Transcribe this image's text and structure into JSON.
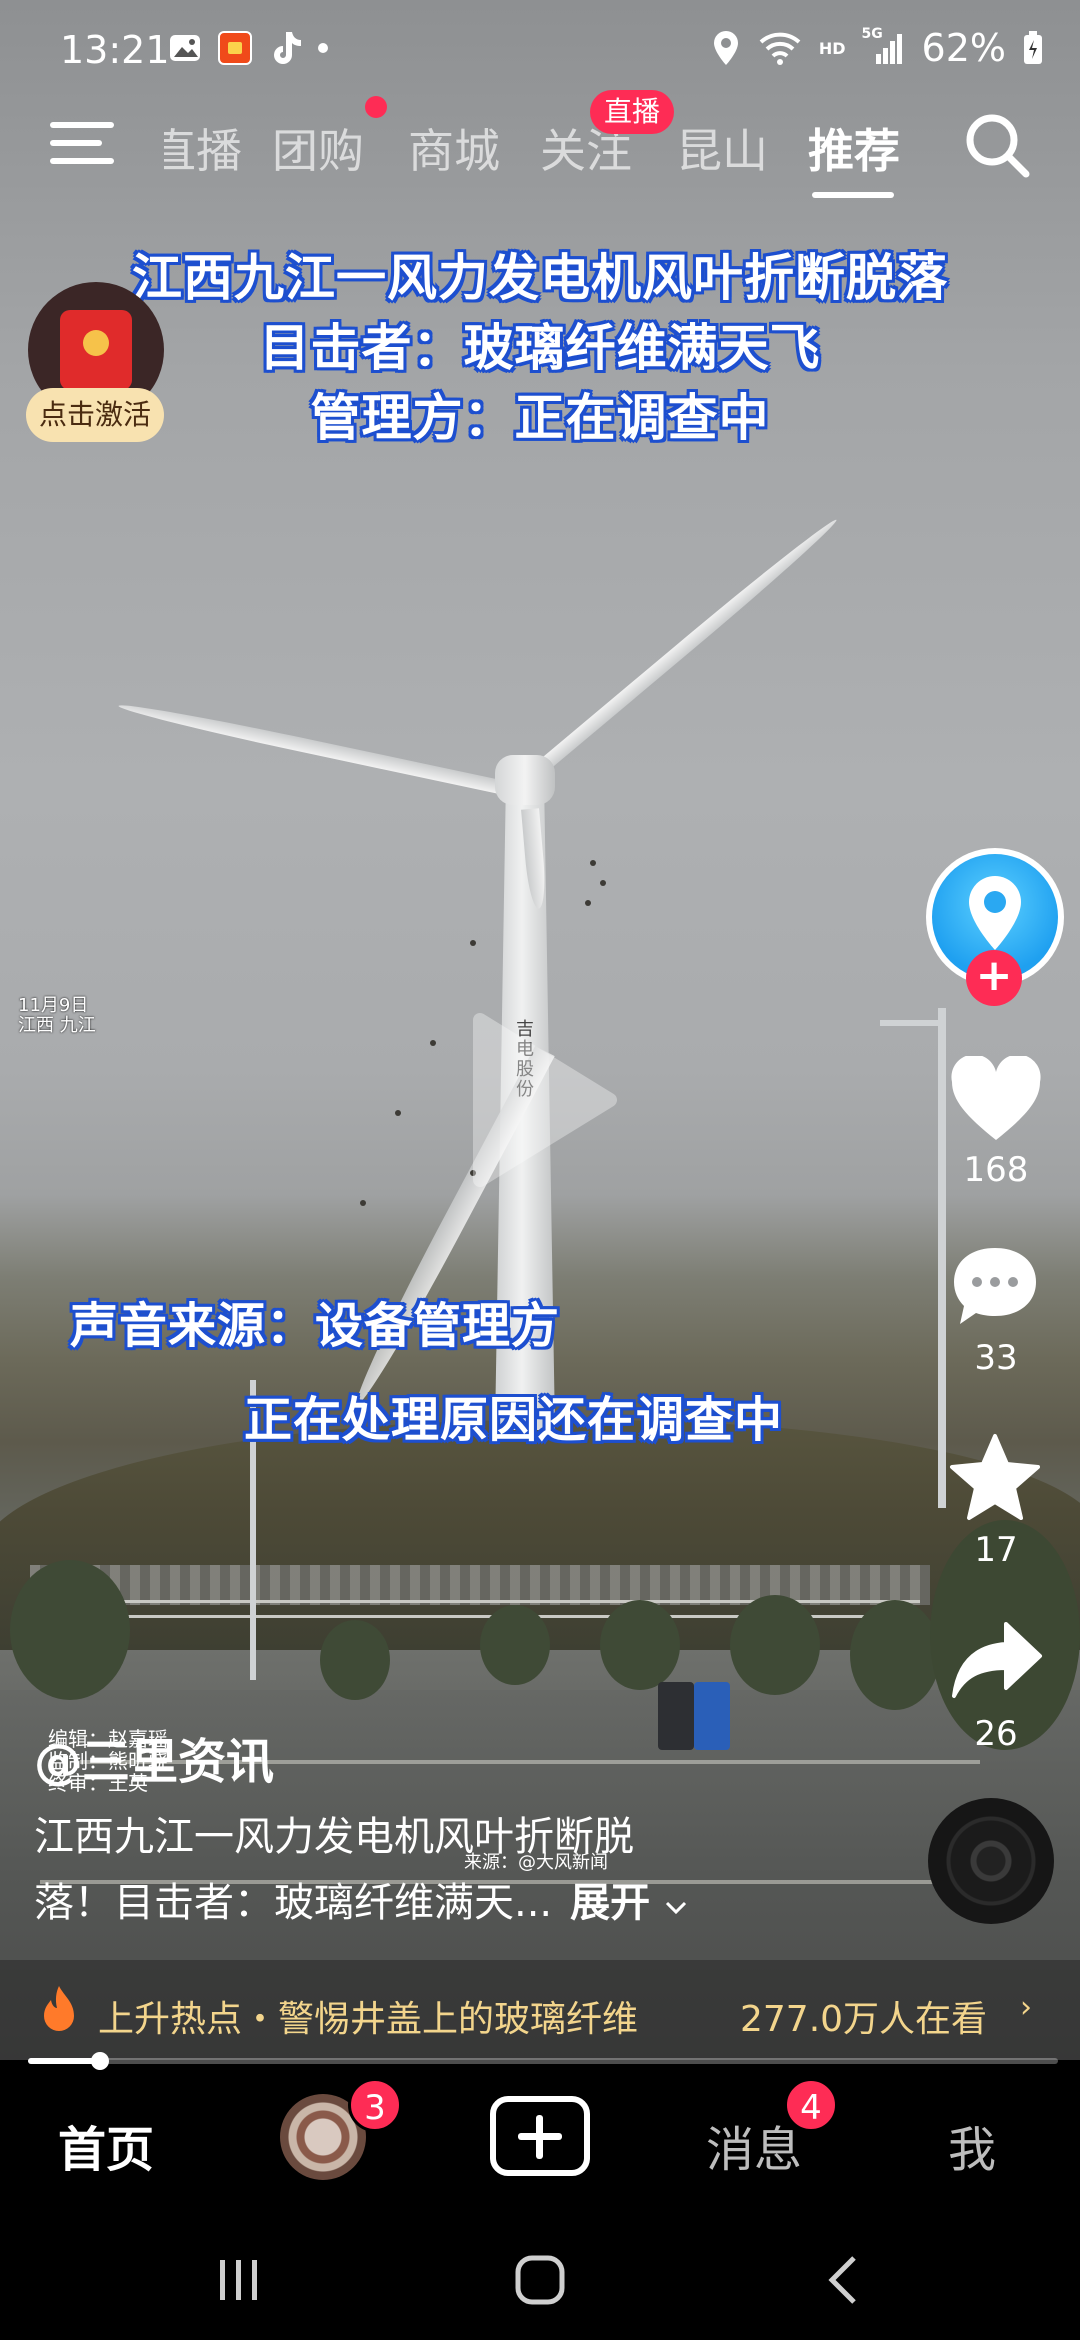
{
  "status_bar": {
    "time": "13:21",
    "network": "HD",
    "signal": "5G",
    "battery": "62%",
    "left_icons": [
      "gallery-icon",
      "app-notification-icon",
      "tiktok-icon",
      "dot-icon"
    ],
    "right_icons": [
      "location-icon",
      "wifi-icon",
      "signal-icon",
      "battery-icon"
    ]
  },
  "top_nav": {
    "tabs": [
      {
        "label": "直播"
      },
      {
        "label": "团购"
      },
      {
        "label": "商城"
      },
      {
        "label": "关注"
      },
      {
        "label": "昆山"
      },
      {
        "label": "推荐"
      }
    ],
    "live_badge": "直播",
    "active_tab": "推荐"
  },
  "promo": {
    "activate_label": "点击激活"
  },
  "video": {
    "headline": [
      "江西九江一风力发电机风叶折断脱落",
      "目击者：玻璃纤维满天飞",
      "管理方：正在调查中"
    ],
    "date_stamp": [
      "11月9日",
      "江西 九江"
    ],
    "subtitle_1": "声音来源：设备管理方",
    "subtitle_2": "正在处理原因还在调查中",
    "tower_text": "吉电股份",
    "credits": [
      "编辑：赵嘉瑶",
      "监制：熊昕骁",
      "终审：王英"
    ],
    "source": "来源：@大风新闻"
  },
  "rail": {
    "likes": "168",
    "comments": "33",
    "favorites": "17",
    "shares": "26"
  },
  "caption": {
    "author": "@三里资讯",
    "line1": "江西九江一风力发电机风叶折断脱",
    "line2": "落！目击者：玻璃纤维满天...",
    "expand": "展开"
  },
  "hot": {
    "text": "上升热点・警惕井盖上的玻璃纤维",
    "count": "277.0万人在看",
    "arrow": "›"
  },
  "progress": 0.07,
  "bottom_nav": {
    "home": "首页",
    "friends_badge": "3",
    "messages": "消息",
    "messages_badge": "4",
    "me": "我"
  },
  "colors": {
    "accent": "#fe2c55",
    "caption_outline": "#1d4fcf",
    "hot_text": "#f3d58c"
  }
}
